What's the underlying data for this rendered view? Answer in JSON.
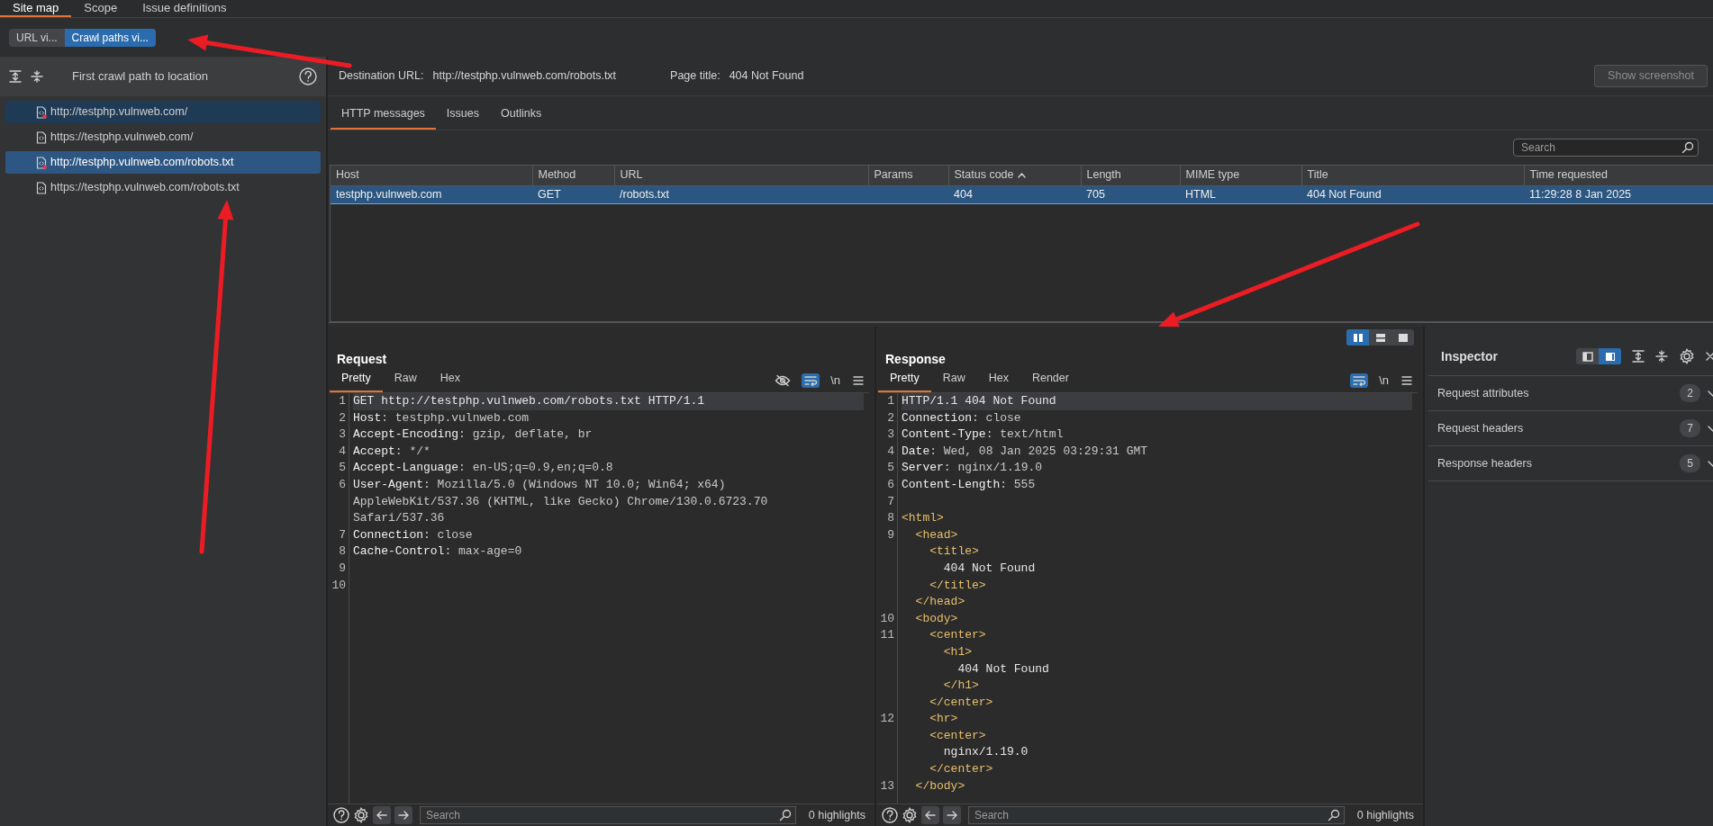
{
  "main_tabs": [
    {
      "label": "Site map",
      "selected": true
    },
    {
      "label": "Scope",
      "selected": false
    },
    {
      "label": "Issue definitions",
      "selected": false
    }
  ],
  "view_toggle": [
    {
      "label": "URL vi...",
      "selected": false
    },
    {
      "label": "Crawl paths vi...",
      "selected": true
    }
  ],
  "crawl_panel": {
    "title": "First crawl path to location",
    "items": [
      {
        "label": "http://testphp.vulnweb.com/",
        "selected": false,
        "on_path": true,
        "has_issue": true
      },
      {
        "label": "https://testphp.vulnweb.com/",
        "selected": false,
        "on_path": false,
        "has_issue": false
      },
      {
        "label": "http://testphp.vulnweb.com/robots.txt",
        "selected": true,
        "on_path": false,
        "has_issue": true
      },
      {
        "label": "https://testphp.vulnweb.com/robots.txt",
        "selected": false,
        "on_path": false,
        "has_issue": false
      }
    ]
  },
  "destination": {
    "url_label": "Destination URL:",
    "url": "http://testphp.vulnweb.com/robots.txt",
    "title_label": "Page title:",
    "title": "404 Not Found",
    "screenshot_button": "Show screenshot"
  },
  "detail_tabs": [
    {
      "label": "HTTP messages",
      "selected": true
    },
    {
      "label": "Issues",
      "selected": false
    },
    {
      "label": "Outlinks",
      "selected": false
    }
  ],
  "search": {
    "placeholder": "Search"
  },
  "table": {
    "columns": [
      {
        "label": "Host",
        "sorted_ascending": false
      },
      {
        "label": "Method",
        "sorted_ascending": false
      },
      {
        "label": "URL",
        "sorted_ascending": false
      },
      {
        "label": "Params",
        "sorted_ascending": false
      },
      {
        "label": "Status code",
        "sorted_ascending": true
      },
      {
        "label": "Length",
        "sorted_ascending": false
      },
      {
        "label": "MIME type",
        "sorted_ascending": false
      },
      {
        "label": "Title",
        "sorted_ascending": false
      },
      {
        "label": "Time requested",
        "sorted_ascending": false
      }
    ],
    "rows": [
      {
        "selected": true,
        "cells": [
          "testphp.vulnweb.com",
          "GET",
          "/robots.txt",
          "",
          "404",
          "705",
          "HTML",
          "404 Not Found",
          "11:29:28 8 Jan 2025"
        ]
      }
    ]
  },
  "layout_toggle": [
    {
      "kind": "columns",
      "selected": true
    },
    {
      "kind": "rows",
      "selected": false
    },
    {
      "kind": "single",
      "selected": false
    }
  ],
  "request": {
    "title": "Request",
    "tabs": [
      {
        "label": "Pretty",
        "selected": true
      },
      {
        "label": "Raw",
        "selected": false
      },
      {
        "label": "Hex",
        "selected": false
      }
    ],
    "tools": [
      {
        "kind": "hide",
        "active": false
      },
      {
        "kind": "wrap",
        "active": true
      },
      {
        "kind": "newline",
        "label": "\\n",
        "active": false
      },
      {
        "kind": "menu",
        "active": false
      }
    ],
    "lines": [
      {
        "number": "1",
        "highlighted": true,
        "rows": [
          [
            {
              "kind": "text",
              "text": "GET http://testphp.vulnweb.com/robots.txt HTTP/1.1"
            }
          ]
        ]
      },
      {
        "number": "2",
        "highlighted": false,
        "rows": [
          [
            {
              "kind": "key",
              "text": "Host"
            },
            {
              "kind": "value",
              "text": ": testphp.vulnweb.com"
            }
          ]
        ]
      },
      {
        "number": "3",
        "highlighted": false,
        "rows": [
          [
            {
              "kind": "key",
              "text": "Accept-Encoding"
            },
            {
              "kind": "value",
              "text": ": gzip, deflate, br"
            }
          ]
        ]
      },
      {
        "number": "4",
        "highlighted": false,
        "rows": [
          [
            {
              "kind": "key",
              "text": "Accept"
            },
            {
              "kind": "value",
              "text": ": */*"
            }
          ]
        ]
      },
      {
        "number": "5",
        "highlighted": false,
        "rows": [
          [
            {
              "kind": "key",
              "text": "Accept-Language"
            },
            {
              "kind": "value",
              "text": ": en-US;q=0.9,en;q=0.8"
            }
          ]
        ]
      },
      {
        "number": "6",
        "highlighted": false,
        "rows": [
          [
            {
              "kind": "key",
              "text": "User-Agent"
            },
            {
              "kind": "value",
              "text": ": Mozilla/5.0 (Windows NT 10.0; Win64; x64)"
            }
          ],
          [
            {
              "kind": "value",
              "text": "AppleWebKit/537.36 (KHTML, like Gecko) Chrome/130.0.6723.70"
            }
          ],
          [
            {
              "kind": "value",
              "text": "Safari/537.36"
            }
          ]
        ]
      },
      {
        "number": "7",
        "highlighted": false,
        "rows": [
          [
            {
              "kind": "key",
              "text": "Connection"
            },
            {
              "kind": "value",
              "text": ": close"
            }
          ]
        ]
      },
      {
        "number": "8",
        "highlighted": false,
        "rows": [
          [
            {
              "kind": "key",
              "text": "Cache-Control"
            },
            {
              "kind": "value",
              "text": ": max-age=0"
            }
          ]
        ]
      },
      {
        "number": "9",
        "highlighted": false
      },
      {
        "number": "10",
        "highlighted": false
      }
    ],
    "footer": {
      "placeholder": "Search",
      "highlights": "0 highlights"
    }
  },
  "response": {
    "title": "Response",
    "tabs": [
      {
        "label": "Pretty",
        "selected": true
      },
      {
        "label": "Raw",
        "selected": false
      },
      {
        "label": "Hex",
        "selected": false
      },
      {
        "label": "Render",
        "selected": false
      }
    ],
    "tools": [
      {
        "kind": "wrap",
        "active": true
      },
      {
        "kind": "newline",
        "label": "\\n",
        "active": false
      },
      {
        "kind": "menu",
        "active": false
      }
    ],
    "lines": [
      {
        "number": "1",
        "highlighted": true,
        "rows": [
          [
            {
              "kind": "text",
              "text": "HTTP/1.1 404 Not Found"
            }
          ]
        ]
      },
      {
        "number": "2",
        "highlighted": false,
        "rows": [
          [
            {
              "kind": "key",
              "text": "Connection"
            },
            {
              "kind": "value",
              "text": ": close"
            }
          ]
        ]
      },
      {
        "number": "3",
        "highlighted": false,
        "rows": [
          [
            {
              "kind": "key",
              "text": "Content-Type"
            },
            {
              "kind": "value",
              "text": ": text/html"
            }
          ]
        ]
      },
      {
        "number": "4",
        "highlighted": false,
        "rows": [
          [
            {
              "kind": "key",
              "text": "Date"
            },
            {
              "kind": "value",
              "text": ": Wed, 08 Jan 2025 03:29:31 GMT"
            }
          ]
        ]
      },
      {
        "number": "5",
        "highlighted": false,
        "rows": [
          [
            {
              "kind": "key",
              "text": "Server"
            },
            {
              "kind": "value",
              "text": ": nginx/1.19.0"
            }
          ]
        ]
      },
      {
        "number": "6",
        "highlighted": false,
        "rows": [
          [
            {
              "kind": "key",
              "text": "Content-Length"
            },
            {
              "kind": "value",
              "text": ": 555"
            }
          ]
        ]
      },
      {
        "number": "7",
        "highlighted": false
      },
      {
        "number": "8",
        "highlighted": false,
        "rows": [
          [
            {
              "kind": "tag",
              "text": "<html>"
            }
          ]
        ]
      },
      {
        "number": "9",
        "highlighted": false,
        "rows": [
          [
            {
              "kind": "tag",
              "text": "  <head>"
            }
          ],
          [
            {
              "kind": "tag",
              "text": "    <title>"
            }
          ],
          [
            {
              "kind": "text",
              "text": "      404 Not Found"
            }
          ],
          [
            {
              "kind": "tag",
              "text": "    </title>"
            }
          ],
          [
            {
              "kind": "tag",
              "text": "  </head>"
            }
          ]
        ]
      },
      {
        "number": "10",
        "highlighted": false,
        "rows": [
          [
            {
              "kind": "tag",
              "text": "  <body>"
            }
          ]
        ]
      },
      {
        "number": "11",
        "highlighted": false,
        "rows": [
          [
            {
              "kind": "tag",
              "text": "    <center>"
            }
          ],
          [
            {
              "kind": "tag",
              "text": "      <h1>"
            }
          ],
          [
            {
              "kind": "text",
              "text": "        404 Not Found"
            }
          ],
          [
            {
              "kind": "tag",
              "text": "      </h1>"
            }
          ],
          [
            {
              "kind": "tag",
              "text": "    </center>"
            }
          ]
        ]
      },
      {
        "number": "12",
        "highlighted": false,
        "rows": [
          [
            {
              "kind": "tag",
              "text": "    <hr>"
            }
          ],
          [
            {
              "kind": "tag",
              "text": "    <center>"
            }
          ],
          [
            {
              "kind": "text",
              "text": "      nginx/1.19.0"
            }
          ],
          [
            {
              "kind": "tag",
              "text": "    </center>"
            }
          ]
        ]
      },
      {
        "number": "13",
        "highlighted": false,
        "rows": [
          [
            {
              "kind": "tag",
              "text": "  </body>"
            }
          ]
        ]
      }
    ],
    "footer": {
      "placeholder": "Search",
      "highlights": "0 highlights"
    }
  },
  "inspector": {
    "title": "Inspector",
    "dock_toggle": [
      {
        "kind": "left",
        "selected": false
      },
      {
        "kind": "right",
        "selected": true
      }
    ],
    "sections": [
      {
        "label": "Request attributes",
        "count": "2",
        "expanded": false
      },
      {
        "label": "Request headers",
        "count": "7",
        "expanded": false
      },
      {
        "label": "Response headers",
        "count": "5",
        "expanded": false
      }
    ]
  }
}
